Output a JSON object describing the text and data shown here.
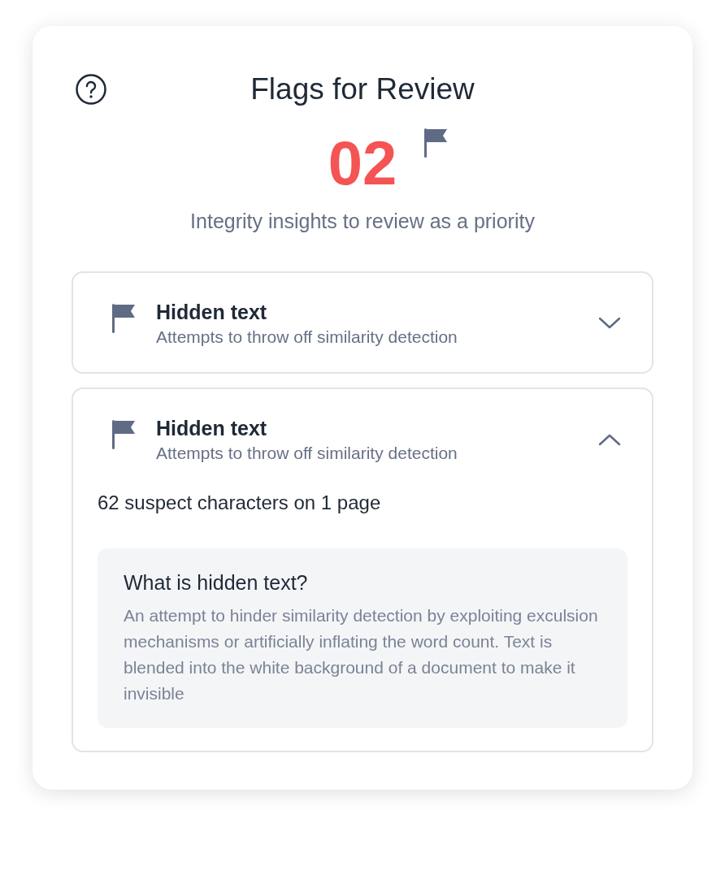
{
  "card": {
    "title": "Flags for Review",
    "count": "02",
    "subtitle": "Integrity insights to review as a priority"
  },
  "flags": [
    {
      "title": "Hidden text",
      "description": "Attempts to throw off similarity detection",
      "expanded": false
    },
    {
      "title": "Hidden text",
      "description": "Attempts to throw off similarity detection",
      "expanded": true,
      "summary": "62 suspect characters on 1 page",
      "info_title": "What is hidden text?",
      "info_text": "An attempt to hinder similarity detection by exploiting exculsion mechanisms or artificially inflating the word count. Text is blended into the white background of a document to make it invisible"
    }
  ]
}
